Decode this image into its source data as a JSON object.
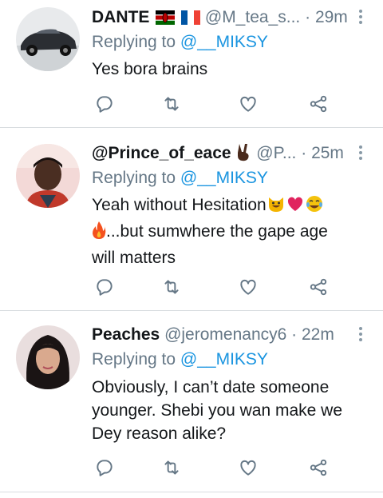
{
  "tweets": [
    {
      "name": "DANTE",
      "handle": "@M_tea_s...",
      "separator": "·",
      "time": "29m",
      "reply_prefix": "Replying to ",
      "reply_to": "@__MIKSY",
      "text_lines": [
        "Yes bora brains"
      ],
      "avatar": "car-photo",
      "flags": [
        "kenya-flag",
        "france-flag"
      ]
    },
    {
      "name": "@Prince_of_eace",
      "handle": "@P...",
      "separator": "·",
      "time": "25m",
      "reply_prefix": "Replying to ",
      "reply_to": "@__MIKSY",
      "text_line1": "Yeah without Hesitation",
      "text_line2": "...but sumwhere the gape age",
      "text_line3": "will matters",
      "avatar": "young-man-photo",
      "emojis": [
        "victory-hand-emoji",
        "grinning-cat-emoji",
        "red-heart-emoji",
        "tears-of-joy-emoji",
        "fire-emoji"
      ]
    },
    {
      "name": "Peaches",
      "handle": "@jeromenancy6",
      "separator": "·",
      "time": "22m",
      "reply_prefix": "Replying to ",
      "reply_to": "@__MIKSY",
      "text_lines": [
        "Obviously, I can’t date someone",
        "younger. Shebi you wan make we",
        "Dey reason alike?"
      ],
      "avatar": "woman-photo"
    }
  ],
  "colors": {
    "name": "#14171a",
    "secondary": "#657786",
    "link": "#1b95e0",
    "divider": "#d9dde0",
    "icon": "#657786"
  },
  "icons": [
    "reply-icon",
    "retweet-icon",
    "like-icon",
    "share-icon",
    "more-icon"
  ]
}
